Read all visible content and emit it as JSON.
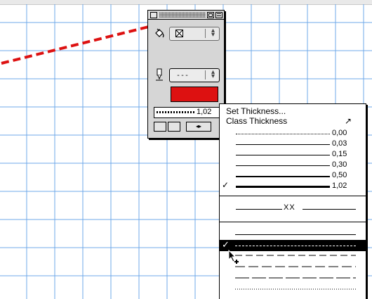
{
  "palette": {
    "pen_style": "---",
    "fill_color": "#dd1111",
    "thickness_value": "1,02"
  },
  "menu": {
    "set_thickness": "Set Thickness...",
    "class_thickness": "Class Thickness",
    "thicknesses": [
      {
        "label": "0,00",
        "checked": false
      },
      {
        "label": "0,03",
        "checked": false
      },
      {
        "label": "0,15",
        "checked": false
      },
      {
        "label": "0,30",
        "checked": false
      },
      {
        "label": "0,50",
        "checked": false
      },
      {
        "label": "1,02",
        "checked": true
      }
    ],
    "xx_label": "XX",
    "dash_styles_selected_index": 1,
    "check_mark": "✓"
  },
  "colors": {
    "grid_line": "#6fa8e8",
    "dash_line": "#dd1111",
    "menu_highlight": "#000000"
  }
}
